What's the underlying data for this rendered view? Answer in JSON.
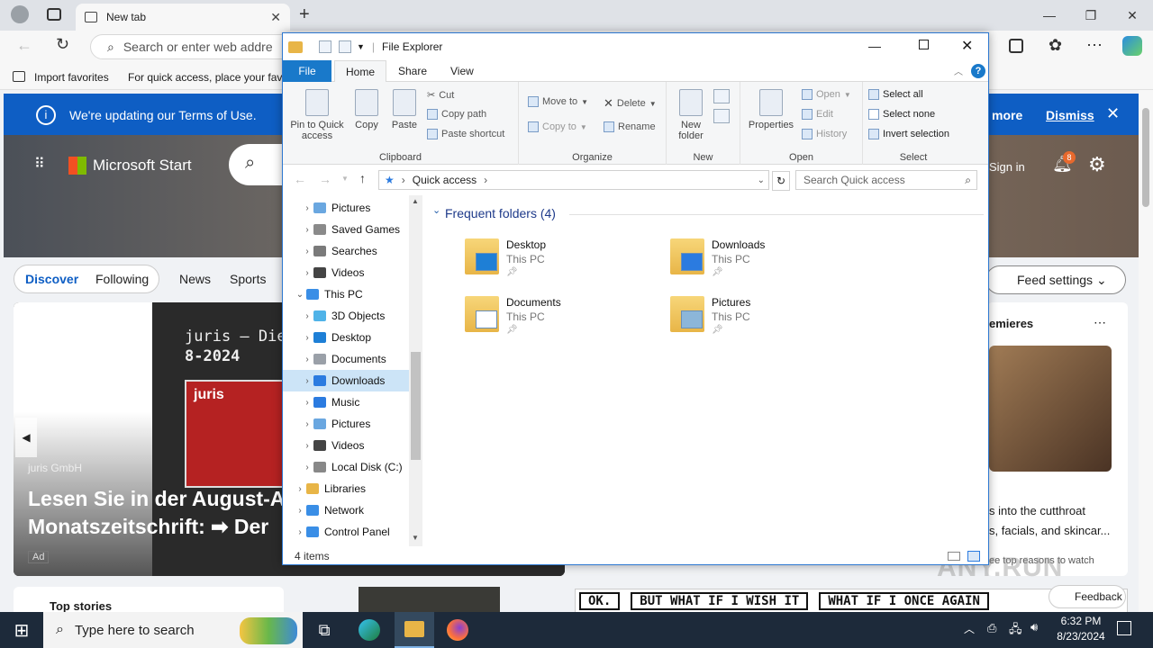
{
  "browser": {
    "tab_title": "New tab",
    "omnibox_placeholder": "Search or enter web addre",
    "favbar": {
      "import_label": "Import favorites",
      "quick_access_text": "For quick access, place your favo"
    }
  },
  "msn": {
    "banner_text": "We're updating our Terms of Use.",
    "banner_more": "more",
    "banner_dismiss": "Dismiss",
    "brand": "Microsoft Start",
    "sign_in": "Sign in",
    "notif_count": "8",
    "nav": {
      "discover": "Discover",
      "following": "Following",
      "news": "News",
      "sports": "Sports"
    },
    "feed_settings": "Feed settings",
    "hero_card": {
      "headline_top": "juris — Die Mo",
      "headline_top2": "8-2024",
      "source": "juris GmbH",
      "title_line1": "Lesen Sie in der August-A",
      "title_line2": "Monatszeitschrift: ➡ Der",
      "ad": "Ad",
      "juris_logo": "juris"
    },
    "side_card": {
      "title": "emieres",
      "text1": "s into the cutthroat",
      "text2": "s, facials, and skincar...",
      "text3": "ee top reasons to watch"
    },
    "top_stories": "Top stories",
    "feedback": "Feedback",
    "comic": {
      "panel1": "OK.",
      "panel2": "BUT WHAT IF I WISH IT",
      "panel3": "WHAT IF I ONCE AGAIN"
    },
    "watermark": "ANY.RUN"
  },
  "explorer": {
    "title": "File Explorer",
    "tabs": [
      "File",
      "Home",
      "Share",
      "View"
    ],
    "ribbon": {
      "clipboard": {
        "pin": "Pin to Quick access",
        "copy": "Copy",
        "paste": "Paste",
        "cut": "Cut",
        "copy_path": "Copy path",
        "paste_shortcut": "Paste shortcut",
        "label": "Clipboard"
      },
      "organize": {
        "move_to": "Move to",
        "copy_to": "Copy to",
        "delete": "Delete",
        "rename": "Rename",
        "label": "Organize"
      },
      "new": {
        "new_folder": "New folder",
        "label": "New"
      },
      "open": {
        "properties": "Properties",
        "open": "Open",
        "edit": "Edit",
        "history": "History",
        "label": "Open"
      },
      "select": {
        "select_all": "Select all",
        "select_none": "Select none",
        "invert": "Invert selection",
        "label": "Select"
      }
    },
    "address": "Quick access",
    "search_placeholder": "Search Quick access",
    "tree": [
      {
        "label": "Pictures",
        "indent": 1,
        "color": "#6aa7e0"
      },
      {
        "label": "Saved Games",
        "indent": 1,
        "color": "#8a8a8a"
      },
      {
        "label": "Searches",
        "indent": 1,
        "color": "#7a7a7a"
      },
      {
        "label": "Videos",
        "indent": 1,
        "color": "#444"
      },
      {
        "label": "This PC",
        "indent": 0,
        "color": "#3a8ee6"
      },
      {
        "label": "3D Objects",
        "indent": 1,
        "color": "#4fb3e8"
      },
      {
        "label": "Desktop",
        "indent": 1,
        "color": "#1e7fd6"
      },
      {
        "label": "Documents",
        "indent": 1,
        "color": "#9aa0a8"
      },
      {
        "label": "Downloads",
        "indent": 1,
        "color": "#2b7be0"
      },
      {
        "label": "Music",
        "indent": 1,
        "color": "#2b7be0"
      },
      {
        "label": "Pictures",
        "indent": 1,
        "color": "#6aa7e0"
      },
      {
        "label": "Videos",
        "indent": 1,
        "color": "#444"
      },
      {
        "label": "Local Disk (C:)",
        "indent": 1,
        "color": "#888"
      },
      {
        "label": "Libraries",
        "indent": 0,
        "color": "#e8b547"
      },
      {
        "label": "Network",
        "indent": 0,
        "color": "#3a8ee6"
      },
      {
        "label": "Control Panel",
        "indent": 0,
        "color": "#3a8ee6"
      }
    ],
    "frequent_header": "Frequent folders (4)",
    "folders": [
      {
        "name": "Desktop",
        "location": "This PC"
      },
      {
        "name": "Downloads",
        "location": "This PC"
      },
      {
        "name": "Documents",
        "location": "This PC"
      },
      {
        "name": "Pictures",
        "location": "This PC"
      }
    ],
    "status": "4 items"
  },
  "taskbar": {
    "search_placeholder": "Type here to search",
    "time": "6:32 PM",
    "date": "8/23/2024"
  }
}
